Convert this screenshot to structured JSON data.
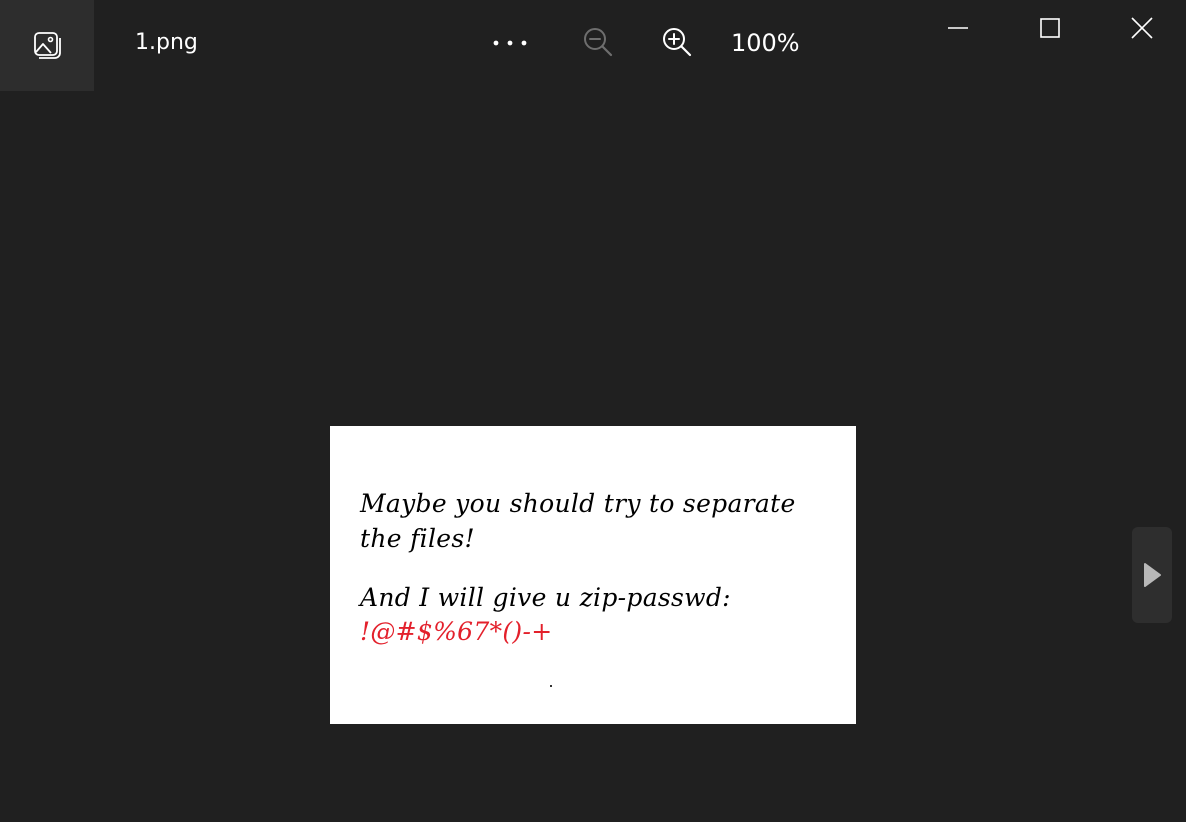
{
  "titlebar": {
    "app_icon": "photo-gallery-icon",
    "file_name": "1.png",
    "more_icon": "more-options-icon",
    "zoom_out_icon": "zoom-out-icon",
    "zoom_in_icon": "zoom-in-icon",
    "zoom_level": "100%",
    "window_controls": {
      "minimize_icon": "minimize-icon",
      "maximize_icon": "maximize-icon",
      "close_icon": "close-icon"
    }
  },
  "image": {
    "lines": [
      "Maybe you should try to separate",
      "the files!",
      "And I will give u zip-passwd:",
      "!@#$%67*()-+"
    ],
    "password_color": "#e3202b"
  },
  "navigation": {
    "next_icon": "next-image-icon"
  }
}
